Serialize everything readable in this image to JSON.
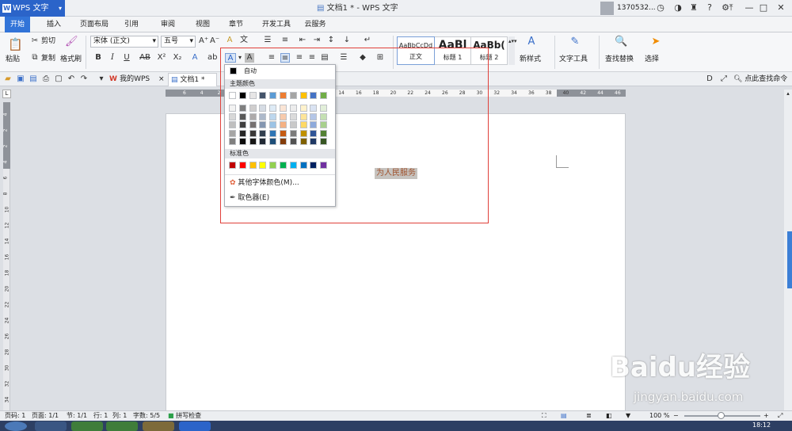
{
  "title_bar": {
    "app_button": "WPS 文字",
    "doc_title": "文档1 * - WPS 文字",
    "user": "1370532..."
  },
  "ribbon_tabs": [
    "开始",
    "插入",
    "页面布局",
    "引用",
    "审阅",
    "视图",
    "章节",
    "开发工具",
    "云服务"
  ],
  "ribbon": {
    "cut": "剪切",
    "copy": "复制",
    "paste": "粘贴",
    "format_painter": "格式刷",
    "font_name": "宋体 (正文)",
    "font_size": "五号",
    "styles": [
      {
        "preview": "AaBbCcDd",
        "label": "正文"
      },
      {
        "preview": "AaBl",
        "label": "标题 1"
      },
      {
        "preview": "AaBb(",
        "label": "标题 2"
      }
    ],
    "new_style": "新样式",
    "text_tools": "文字工具",
    "find_replace": "查找替换",
    "select": "选择"
  },
  "quick_access": {
    "tab_mywps": "我的WPS",
    "tab_doc": "文档1 *",
    "search_cmd": "点此查找命令"
  },
  "ruler": {
    "h_ticks": [
      "6",
      "4",
      "2",
      "2",
      "4",
      "6",
      "8",
      "10",
      "12",
      "14",
      "16",
      "18",
      "20",
      "22",
      "24",
      "26",
      "28",
      "30",
      "32",
      "34",
      "36",
      "38",
      "40",
      "42",
      "44",
      "46"
    ],
    "v_ticks": [
      "4",
      "2",
      "2",
      "4",
      "6",
      "8",
      "10",
      "12",
      "14",
      "16",
      "18",
      "20",
      "22",
      "24",
      "26",
      "28",
      "30",
      "32",
      "34"
    ]
  },
  "document": {
    "text": "为人民服务"
  },
  "color_panel": {
    "auto_label": "自动",
    "theme_header": "主题颜色",
    "standard_header": "标准色",
    "more_colors": "其他字体颜色(M)...",
    "eyedropper": "取色器(E)",
    "theme_row": [
      "#ffffff",
      "#000000",
      "#e7e6e6",
      "#44546a",
      "#5b9bd5",
      "#ed7d31",
      "#a5a5a5",
      "#ffc000",
      "#4472c4",
      "#70ad47"
    ],
    "theme_shades": [
      [
        "#f2f2f2",
        "#7f7f7f",
        "#d0cece",
        "#d6dce4",
        "#deebf6",
        "#fbe5d5",
        "#ededed",
        "#fff2cc",
        "#dae3f3",
        "#e2efd9"
      ],
      [
        "#d8d8d8",
        "#595959",
        "#aeabab",
        "#adb9ca",
        "#bdd7ee",
        "#f7cbac",
        "#dbdbdb",
        "#fee599",
        "#b4c6e7",
        "#c5e0b3"
      ],
      [
        "#bfbfbf",
        "#3f3f3f",
        "#757070",
        "#8496b0",
        "#9cc3e5",
        "#f4b183",
        "#c9c9c9",
        "#ffd965",
        "#8eaadb",
        "#a8d08d"
      ],
      [
        "#a5a5a5",
        "#262626",
        "#3a3838",
        "#323f4f",
        "#2e75b5",
        "#c55a11",
        "#7b7b7b",
        "#bf9000",
        "#2f5496",
        "#538135"
      ],
      [
        "#7f7f7f",
        "#0c0c0c",
        "#171616",
        "#222a35",
        "#1e4e79",
        "#833c0b",
        "#525252",
        "#7f6000",
        "#1f3864",
        "#375623"
      ]
    ],
    "standard_row": [
      "#c00000",
      "#ff0000",
      "#ffc000",
      "#ffff00",
      "#92d050",
      "#00b050",
      "#00b0f0",
      "#0070c0",
      "#002060",
      "#7030a0"
    ]
  },
  "status_bar": {
    "page": "页码: 1",
    "pages": "页面: 1/1",
    "section": "节: 1/1",
    "row": "行: 1",
    "col": "列: 1",
    "words": "字数: 5/5",
    "spell": "拼写检查",
    "zoom": "100 %"
  },
  "taskbar": {
    "time": "18:12"
  },
  "watermark": {
    "brand": "Baidu经验",
    "url": "jingyan.baidu.com"
  }
}
